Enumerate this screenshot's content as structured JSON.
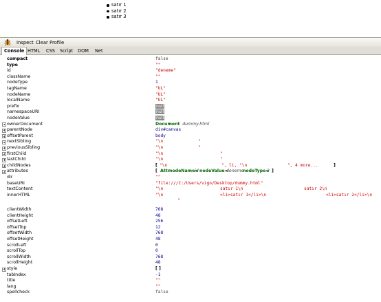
{
  "page": {
    "list_items": [
      "satır 1",
      "satır 2",
      "satır 3"
    ]
  },
  "toolbar": {
    "inspect_label": "Inspect",
    "clear_label": "Clear",
    "profile_label": "Profile"
  },
  "tabs": [
    "Console",
    "HTML",
    "CSS",
    "Script",
    "DOM",
    "Net"
  ],
  "props": {
    "compact": "compact",
    "compact_v": "false",
    "type": "type",
    "type_v": "\"\"",
    "id": "id",
    "id_v": "\"deneme\"",
    "className": "className",
    "className_v": "\"\"",
    "nodeType": "nodeType",
    "nodeType_v": "1",
    "tagName": "tagName",
    "tagName_v": "\"UL\"",
    "nodeName": "nodeName",
    "nodeName_v": "\"UL\"",
    "localName": "localName",
    "localName_v": "\"UL\"",
    "prefix": "prefix",
    "prefix_v": "null",
    "namespaceURI": "namespaceURI",
    "namespaceURI_v": "null",
    "nodeValue": "nodeValue",
    "nodeValue_v": "null",
    "ownerDocument": "ownerDocument",
    "ownerDocument_v1": "Document",
    "ownerDocument_v2": "dummy.html",
    "parentNode": "parentNode",
    "parentNode_v": "div#canvas",
    "offsetParent": "offsetParent",
    "offsetParent_v": "body",
    "nextSibling": "nextSibling",
    "nextSibling_v1": "\"\\n",
    "nextSibling_v2": "\"",
    "previousSibling": "previousSibling",
    "previousSibling_v1": "\"\\n",
    "previousSibling_v2": "\"",
    "firstChild": "firstChild",
    "firstChild_v1": "\"\\n",
    "firstChild_v2": "\"",
    "lastChild": "lastChild",
    "lastChild_v1": "\"\\n",
    "lastChild_v2": "\"",
    "childNodes": "childNodes",
    "childNodes_open": "[",
    "childNodes_s1": "\"\\n",
    "childNodes_s2": "\", li, \"\\n",
    "childNodes_s3": "\", 4 more...",
    "childNodes_close": "]",
    "attributes": "attributes",
    "attributes_open": "[",
    "attributes_attr": "Attr",
    "attributes_nn_label": "nodeName=",
    "attributes_nn": "id",
    "attributes_nv_label": "nodeValue=",
    "attributes_nv": "deneme",
    "attributes_nt_label": "nodeType=",
    "attributes_nt": "2",
    "attributes_close": "]",
    "dir": "dir",
    "dir_v": "\"\"",
    "baseURI": "baseURI",
    "baseURI_v": "\"file:///C:/Users/vigo/Desktop/dummy.html\"",
    "textContent": "textContent",
    "textContent_v1": "\"\\n",
    "textContent_v2": "satır 1\\n",
    "textContent_v3": "satır 2\\n",
    "innerHTML": "innerHTML",
    "innerHTML_v1": "\"\\n",
    "innerHTML_v2": "<li>satır 1</li>\\n",
    "innerHTML_v3": "<li>satır 2</li>\\n",
    "innerHTML_cont": "\"",
    "clientWidth": "clientWidth",
    "clientWidth_v": "768",
    "clientHeight": "clientHeight",
    "clientHeight_v": "48",
    "offsetLeft": "offsetLeft",
    "offsetLeft_v": "256",
    "offsetTop": "offsetTop",
    "offsetTop_v": "12",
    "offsetWidth": "offsetWidth",
    "offsetWidth_v": "768",
    "offsetHeight": "offsetHeight",
    "offsetHeight_v": "48",
    "scrollLeft": "scrollLeft",
    "scrollLeft_v": "0",
    "scrollTop": "scrollTop",
    "scrollTop_v": "0",
    "scrollWidth": "scrollWidth",
    "scrollWidth_v": "768",
    "scrollHeight": "scrollHeight",
    "scrollHeight_v": "48",
    "style": "style",
    "style_v": "[ ]",
    "tabIndex": "tabIndex",
    "tabIndex_v": "-1",
    "title": "title",
    "title_v": "\"\"",
    "lang": "lang",
    "lang_v": "\"\"",
    "spellcheck": "spellcheck",
    "spellcheck_v": "false"
  }
}
